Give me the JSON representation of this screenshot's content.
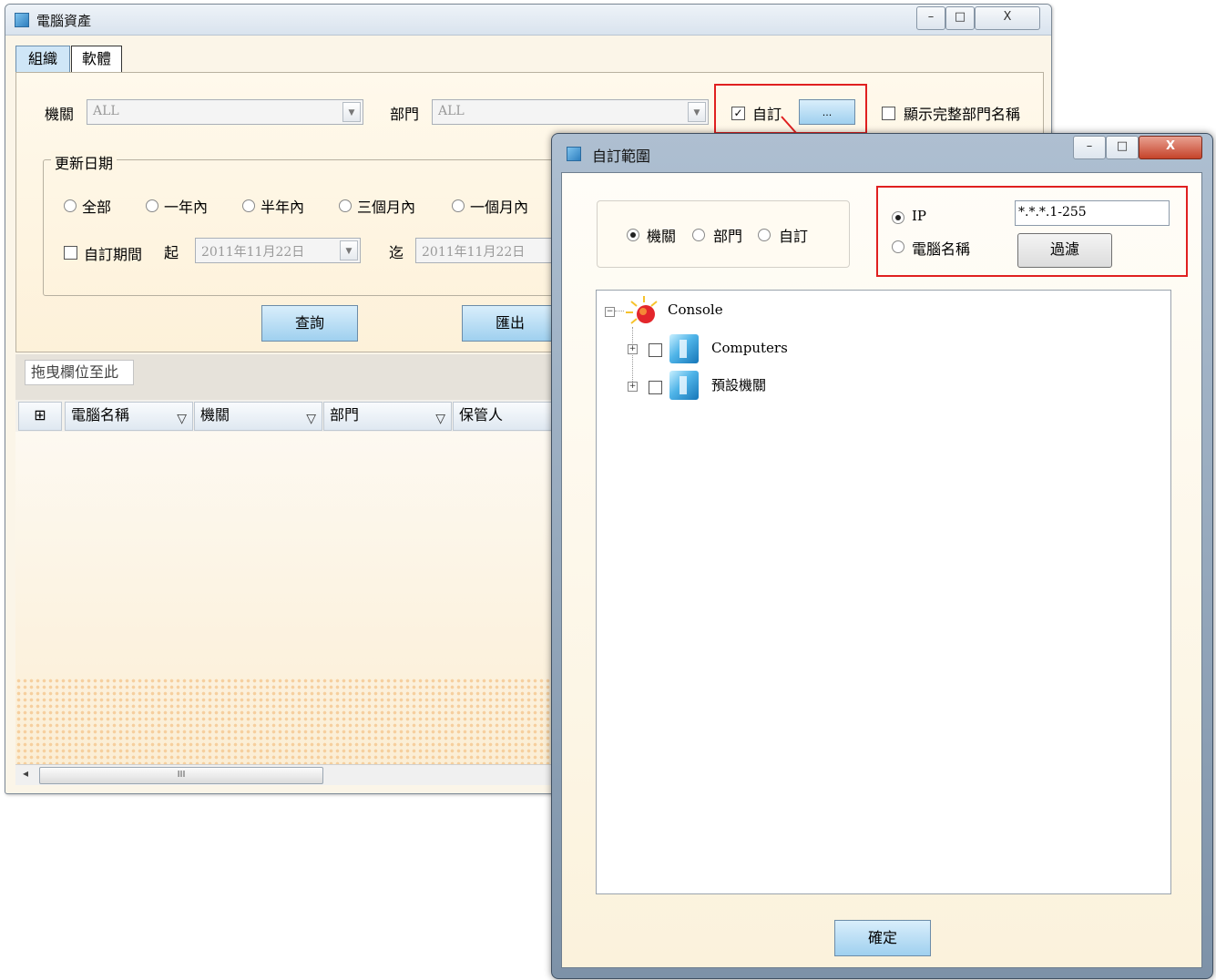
{
  "main_window": {
    "title": "電腦資產",
    "window_controls": {
      "minimize": "–",
      "maximize": "□",
      "close": "X"
    },
    "tabs": [
      {
        "label": "組織",
        "active": true
      },
      {
        "label": "軟體",
        "active": false
      }
    ],
    "filters": {
      "org_label": "機關",
      "org_value": "ALL",
      "dept_label": "部門",
      "dept_value": "ALL",
      "custom_label": "自訂",
      "custom_checked": true,
      "custom_browse_label": "...",
      "show_full_dept_label": "顯示完整部門名稱",
      "show_full_dept_checked": false
    },
    "update_date": {
      "group_label": "更新日期",
      "ranges": [
        "全部",
        "一年內",
        "半年內",
        "三個月內",
        "一個月內"
      ],
      "custom_period_label": "自訂期間",
      "from_label": "起",
      "from_value": "2011年11月22日",
      "to_label": "迄",
      "to_value": "2011年11月22日"
    },
    "actions": {
      "query": "查詢",
      "export": "匯出"
    },
    "grid": {
      "drag_hint": "拖曳欄位至此",
      "columns": [
        "電腦名稱",
        "機關",
        "部門",
        "保管人"
      ],
      "scroll_grip": "III",
      "scroll_left": "◂"
    }
  },
  "dialog": {
    "title": "自訂範圍",
    "window_controls": {
      "minimize": "–",
      "maximize": "□",
      "close": "X"
    },
    "scope_options": [
      {
        "label": "機關",
        "selected": true
      },
      {
        "label": "部門",
        "selected": false
      },
      {
        "label": "自訂",
        "selected": false
      }
    ],
    "filter_by": {
      "ip_label": "IP",
      "ip_selected": true,
      "ip_value": "*.*.*.1-255",
      "name_label": "電腦名稱",
      "name_selected": false,
      "filter_button": "過濾"
    },
    "tree": {
      "root": "Console",
      "children": [
        "Computers",
        "預設機關"
      ],
      "collapse_glyph": "−",
      "expand_glyph": "+"
    },
    "ok_button": "確定"
  },
  "annotation": {
    "color": "#e02020"
  },
  "icons": [
    "app-icon",
    "sun-console-icon",
    "building-icon",
    "funnel-filter-icon",
    "column-chooser-icon"
  ]
}
